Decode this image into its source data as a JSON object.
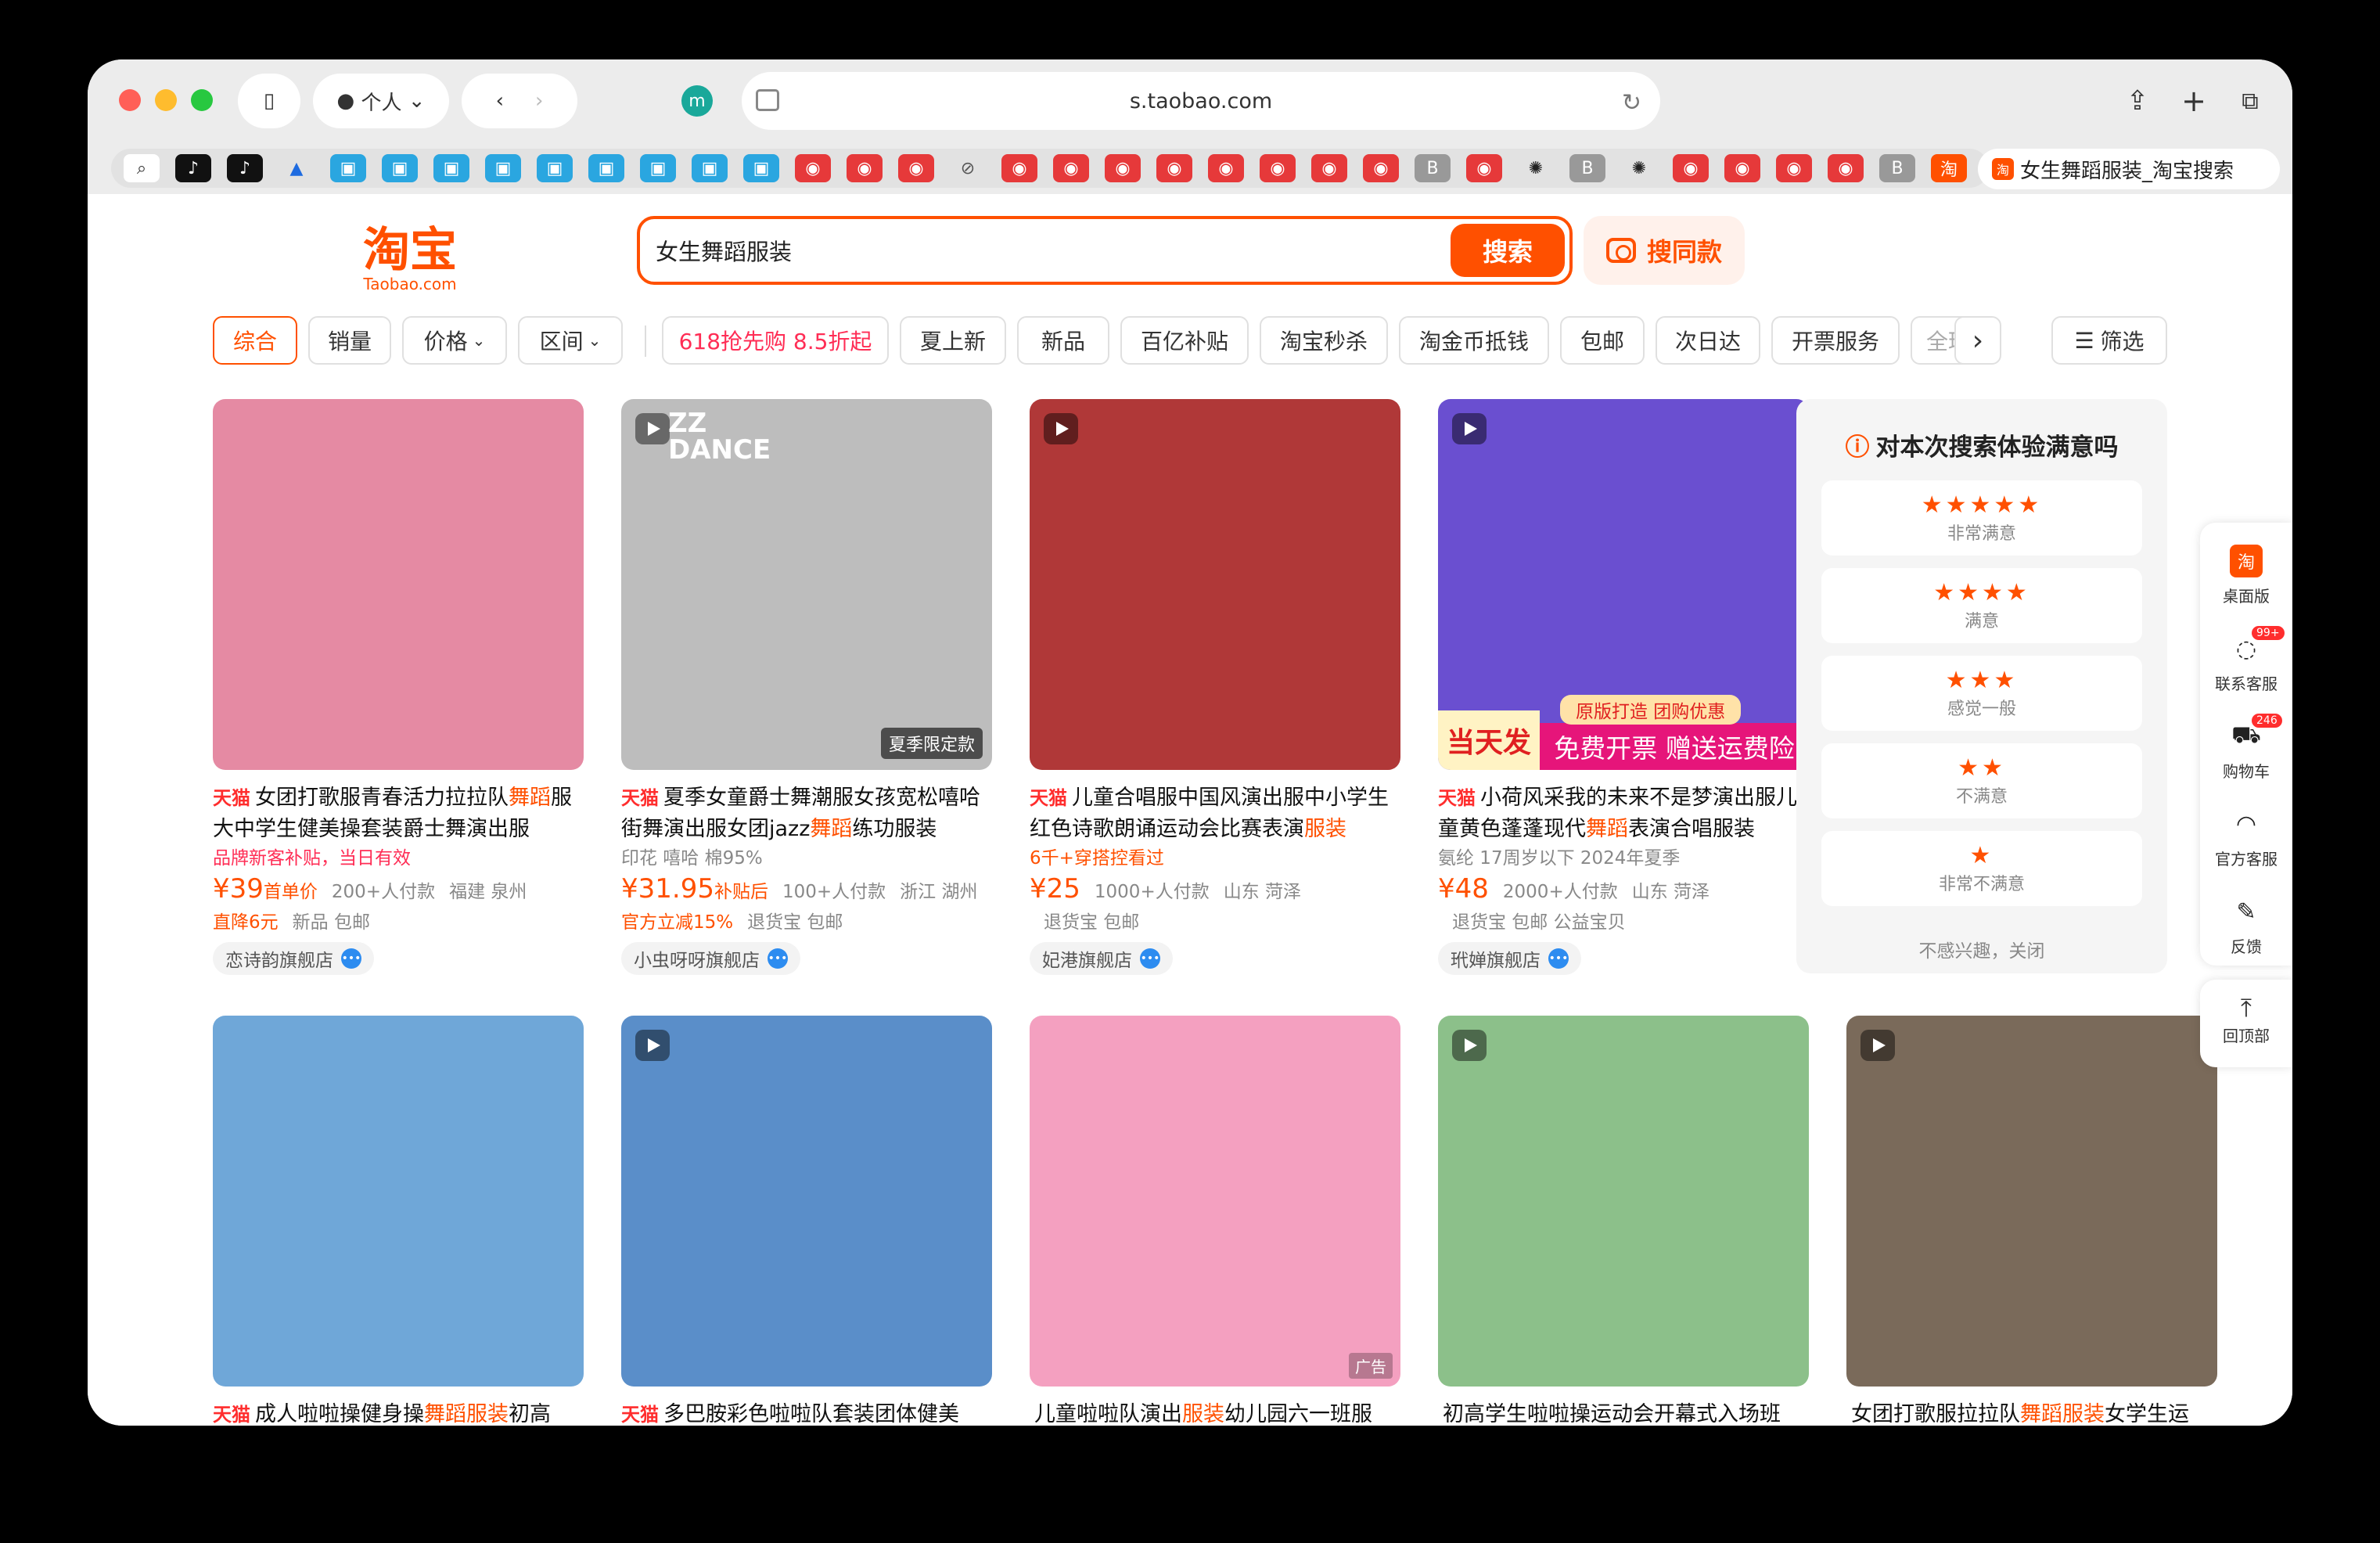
{
  "browser": {
    "url": "s.taobao.com",
    "profile_label": "个人",
    "active_tab_title": "女生舞蹈服装_淘宝搜索",
    "lights": [
      "#ff5f57",
      "#febc2e",
      "#28c840"
    ]
  },
  "header": {
    "logo_cn": "淘宝",
    "logo_en": "Taobao.com",
    "search_value": "女生舞蹈服装",
    "search_button": "搜索",
    "image_search_button": "搜同款"
  },
  "filters": {
    "sort": [
      "综合",
      "销量",
      "价格",
      "区间"
    ],
    "promo": "618抢先购 8.5折起",
    "tags": [
      "夏上新",
      "新品",
      "百亿补贴",
      "淘宝秒杀",
      "淘金币抵钱",
      "包邮",
      "次日达",
      "开票服务",
      "全球"
    ],
    "filter_button": "筛选"
  },
  "products_row1": [
    {
      "brand": "天猫",
      "title_a": "女团打歌服青春活力拉拉队",
      "title_hl": "舞蹈",
      "title_b": "服大中学生健美操套装爵士舞演出服",
      "line1": "品牌新客补贴，当日有效",
      "price": "¥39",
      "price_label": "首单价",
      "sales": "200+人付款",
      "location": "福建 泉州",
      "tag_red": "直降6元",
      "tags": "新品  包邮",
      "shop": "恋诗韵旗舰店",
      "bg": "#e58aa3"
    },
    {
      "brand": "天猫",
      "title_a": "夏季女童爵士舞潮服女孩宽松嘻哈街舞演出服女团jazz",
      "title_hl": "舞蹈",
      "title_b": "练功服装",
      "line1": "印花   嘻哈   棉95%",
      "price": "¥31.95",
      "price_label": "补贴后",
      "sales": "100+人付款",
      "location": "浙江 湖州",
      "tag_red": "官方立减15%",
      "tags": "退货宝  包邮",
      "shop": "小虫呀呀旗舰店",
      "badge": "夏季限定款",
      "overlay": "ZZ DANCE",
      "bg": "#bdbdbd"
    },
    {
      "brand": "天猫",
      "title_a": "儿童合唱服中国风演出服中小学生红色诗歌朗诵运动会比赛表演",
      "title_hl": "服装",
      "title_b": "",
      "line1": "6千+穿搭控看过",
      "price": "¥25",
      "price_label": "",
      "sales": "1000+人付款",
      "location": "山东 菏泽",
      "tag_red": "",
      "tags": "退货宝  包邮",
      "shop": "妃港旗舰店",
      "bg": "#b03838"
    },
    {
      "brand": "天猫",
      "title_a": "小荷风采我的未来不是梦演出服儿童黄色蓬蓬现代",
      "title_hl": "舞蹈",
      "title_b": "表演合唱服装",
      "line1": "氨纶   17周岁以下   2024年夏季",
      "price": "¥48",
      "price_label": "",
      "sales": "2000+人付款",
      "location": "山东 菏泽",
      "tag_red": "",
      "tags": "退货宝  包邮  公益宝贝",
      "shop": "玳婵旗舰店",
      "banner_left": "当天发",
      "banner_top": "原版打造 团购优惠",
      "banner_main": "免费开票 赠送运费险",
      "bg": "#6a4fd0"
    }
  ],
  "products_row2": [
    {
      "brand": "天猫",
      "title_a": "成人啦啦操健身操",
      "title_hl": "舞蹈服装",
      "title_b": "初高",
      "bg": "#6fa7d8"
    },
    {
      "brand": "天猫",
      "title_a": "多巴胺彩色啦啦队套装团体健美",
      "title_hl": "",
      "title_b": "",
      "bg": "#5a8ec9"
    },
    {
      "brand": "",
      "title_a": "儿童啦啦队演出",
      "title_hl": "服装",
      "title_b": "幼儿园六一班服",
      "bg": "#f4a0c0",
      "ad": "广告"
    },
    {
      "brand": "",
      "title_a": "初高学生啦啦操运动会开幕式入场班",
      "title_hl": "",
      "title_b": "",
      "bg": "#8cc08a"
    },
    {
      "brand": "",
      "title_a": "女团打歌服拉拉队",
      "title_hl": "舞蹈服装",
      "title_b": "女学生运",
      "bg": "#7a6a5a"
    }
  ],
  "feedback": {
    "title": "对本次搜索体验满意吗",
    "options": [
      {
        "stars": "★★★★★",
        "label": "非常满意"
      },
      {
        "stars": "★★★★",
        "label": "满意"
      },
      {
        "stars": "★★★",
        "label": "感觉一般"
      },
      {
        "stars": "★★",
        "label": "不满意"
      },
      {
        "stars": "★",
        "label": "非常不满意"
      }
    ],
    "close": "不感兴趣，关闭"
  },
  "rail": {
    "desktop": "桌面版",
    "service": "联系客服",
    "service_badge": "99+",
    "cart": "购物车",
    "cart_badge": "246",
    "official": "官方客服",
    "feedback": "反馈",
    "top": "回顶部"
  }
}
